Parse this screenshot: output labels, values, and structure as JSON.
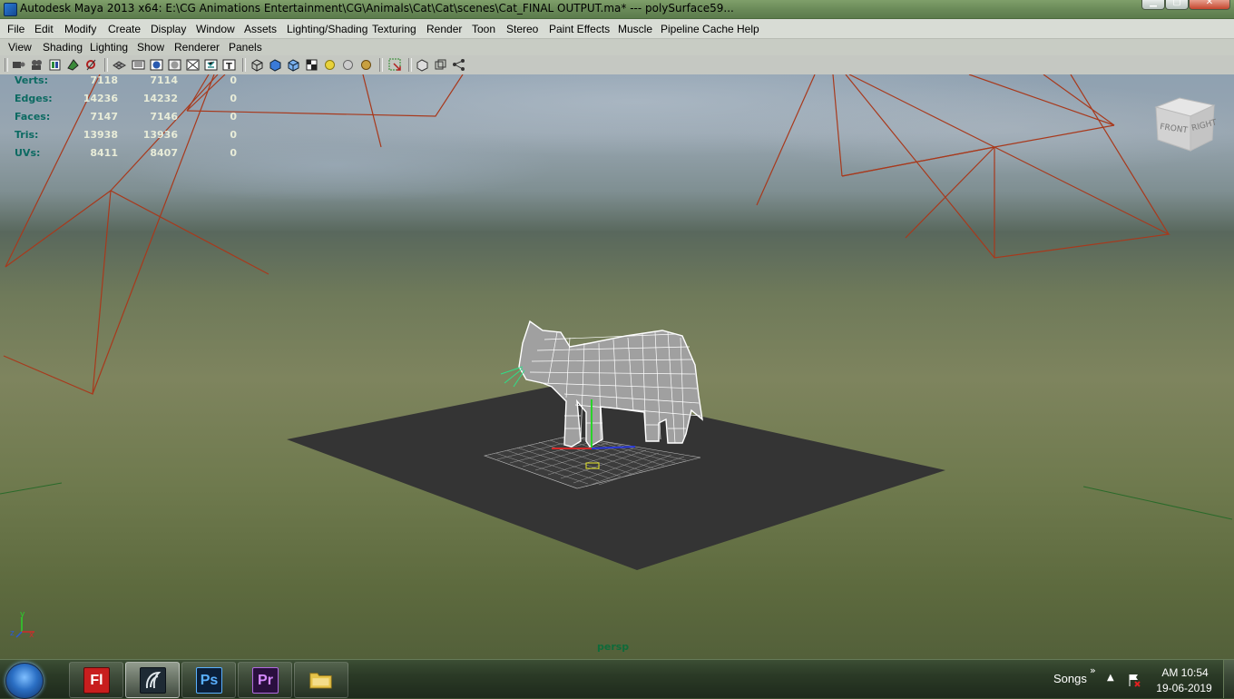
{
  "window": {
    "title": "Autodesk Maya 2013 x64: E:\\CG Animations Entertainment\\CG\\Animals\\Cat\\Cat\\scenes\\Cat_FINAL OUTPUT.ma*   ---   polySurface59..."
  },
  "main_menu": [
    "File",
    "Edit",
    "Modify",
    "Create",
    "Display",
    "Window",
    "Assets",
    "Lighting/Shading",
    "Texturing",
    "Render",
    "Toon",
    "Stereo",
    "Paint Effects",
    "Muscle",
    "Pipeline Cache",
    "Help"
  ],
  "panel_menu": [
    "View",
    "Shading",
    "Lighting",
    "Show",
    "Renderer",
    "Panels"
  ],
  "panel_toolbar_icons": [
    "select-camera-icon",
    "camera-attributes-icon",
    "bookmark-icon",
    "image-plane-icon",
    "two-d-pan-zoom-icon",
    "grid-icon",
    "film-gate-icon",
    "resolution-gate-icon",
    "gate-mask-icon",
    "field-chart-icon",
    "safe-action-icon",
    "safe-title-icon",
    "wireframe-icon",
    "smooth-shade-icon",
    "wireframe-on-shaded-icon",
    "textured-icon",
    "use-all-lights-icon",
    "shadows-icon",
    "ambient-occlusion-icon",
    "isolate-select-icon",
    "x-ray-icon",
    "x-ray-joints-icon",
    "xray-components-icon"
  ],
  "hud": {
    "rows": [
      {
        "label": "Verts:",
        "v1": "7118",
        "v2": "7114",
        "v3": "0"
      },
      {
        "label": "Edges:",
        "v1": "14236",
        "v2": "14232",
        "v3": "0"
      },
      {
        "label": "Faces:",
        "v1": "7147",
        "v2": "7146",
        "v3": "0"
      },
      {
        "label": "Tris:",
        "v1": "13938",
        "v2": "13936",
        "v3": "0"
      },
      {
        "label": "UVs:",
        "v1": "8411",
        "v2": "8407",
        "v3": "0"
      }
    ]
  },
  "viewcube": {
    "front": "FRONT",
    "right": "RIGHT"
  },
  "camera_label": "persp",
  "axis": {
    "y": "y",
    "z": "z",
    "x": "x"
  },
  "taskbar": {
    "apps": [
      {
        "name": "flash",
        "glyph": "Fl",
        "color": "#c81e1e",
        "active": false
      },
      {
        "name": "maya",
        "glyph": "",
        "color": "#2a3a4a",
        "active": true
      },
      {
        "name": "photoshop",
        "glyph": "Ps",
        "color": "#2a6fe0",
        "active": false
      },
      {
        "name": "premiere",
        "glyph": "Pr",
        "color": "#7c3aed",
        "active": false
      },
      {
        "name": "explorer",
        "glyph": "",
        "color": "#e6c34a",
        "active": false
      }
    ],
    "tray_label": "Songs",
    "clock_time": "AM 10:54",
    "clock_date": "19-06-2019"
  },
  "colors": {
    "hud_label": "#0c6a62",
    "camera_lines": "#b03a1e",
    "ground_plane": "#333333",
    "wireframe": "#ffffff"
  }
}
